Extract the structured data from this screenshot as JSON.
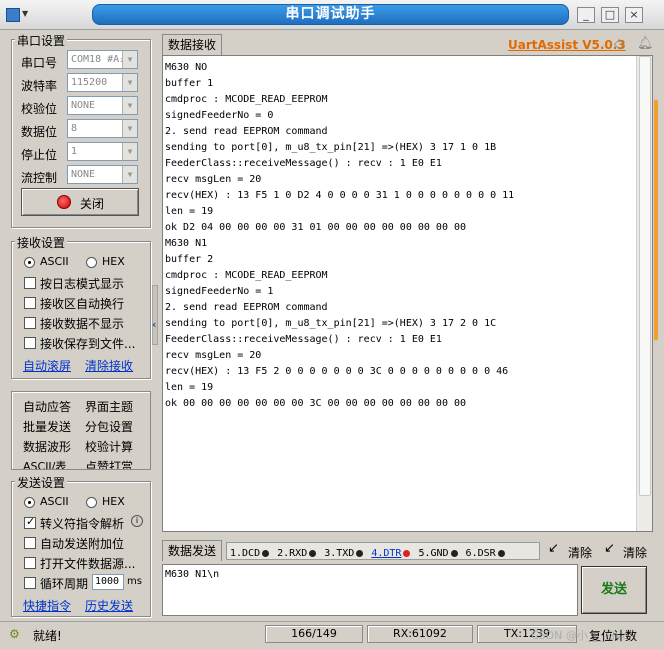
{
  "window": {
    "title": "串口调试助手",
    "minimize": "_",
    "restore": "□",
    "close": "×"
  },
  "port_settings": {
    "title": "串口设置",
    "rows": [
      {
        "label": "串口号",
        "value": "COM18 #A₂"
      },
      {
        "label": "波特率",
        "value": "115200"
      },
      {
        "label": "校验位",
        "value": "NONE"
      },
      {
        "label": "数据位",
        "value": "8"
      },
      {
        "label": "停止位",
        "value": "1"
      },
      {
        "label": "流控制",
        "value": "NONE"
      }
    ],
    "close_button": "关闭"
  },
  "recv_settings": {
    "title": "接收设置",
    "ascii": "ASCII",
    "hex": "HEX",
    "options": [
      "按日志模式显示",
      "接收区自动换行",
      "接收数据不显示",
      "接收保存到文件..."
    ],
    "link_autoscroll": "自动滚屏",
    "link_clear": "清除接收"
  },
  "tools": {
    "items": [
      "自动应答",
      "界面主题",
      "批量发送",
      "分包设置",
      "数据波形",
      "校验计算",
      "ASCII/表",
      "点赞打赏"
    ]
  },
  "send_settings": {
    "title": "发送设置",
    "ascii": "ASCII",
    "hex": "HEX",
    "options": [
      "转义符指令解析",
      "自动发送附加位",
      "打开文件数据源...",
      "循环周期"
    ],
    "cycle_value": "1000",
    "cycle_unit": "ms",
    "link_shortcut": "快捷指令",
    "link_history": "历史发送"
  },
  "recv_tab": "数据接收",
  "brand": "UartAssist V5.0.3",
  "receive_lines": [
    "M630 NO",
    "buffer 1",
    "cmdproc : MCODE_READ_EEPROM",
    "signedFeederNo = 0",
    "2. send read EEPROM command",
    "sending to port[0], m_u8_tx_pin[21] =>(HEX) 3 17 1 0 1B",
    "FeederClass::receiveMessage() : recv : 1 E0 E1",
    "recv msgLen = 20",
    "recv(HEX) : 13 F5 1 0 D2 4 0 0 0 0 31 1 0 0 0 0 0 0 0 0 11",
    "len = 19",
    "ok D2 04 00 00 00 00 31 01 00 00 00 00 00 00 00 00",
    "M630 N1",
    "buffer 2",
    "cmdproc : MCODE_READ_EEPROM",
    "signedFeederNo = 1",
    "2. send read EEPROM command",
    "sending to port[0], m_u8_tx_pin[21] =>(HEX) 3 17 2 0 1C",
    "FeederClass::receiveMessage() : recv : 1 E0 E1",
    "recv msgLen = 20",
    "recv(HEX) : 13 F5 2 0 0 0 0 0 0 0 3C 0 0 0 0 0 0 0 0 0 46",
    "len = 19",
    "ok 00 00 00 00 00 00 00 3C 00 00 00 00 00 00 00 00"
  ],
  "send_bar": {
    "tab": "数据发送",
    "pins": [
      "1.DCD",
      "2.RXD",
      "3.TXD",
      "4.DTR",
      "5.GND",
      "6.DSR"
    ],
    "pin_colors": [
      "#222222",
      "#222222",
      "#222222",
      "#e02020",
      "#222222",
      "#222222"
    ],
    "clear1": "清除",
    "clear2": "清除"
  },
  "send_input": "M630 N1\\n",
  "send_button": "发送",
  "status": {
    "ready": "就绪!",
    "count": "166/149",
    "rx": "RX:61092",
    "tx": "TX:1239",
    "watermark": "CSDN @小___白yd",
    "reset": "复位计数"
  }
}
